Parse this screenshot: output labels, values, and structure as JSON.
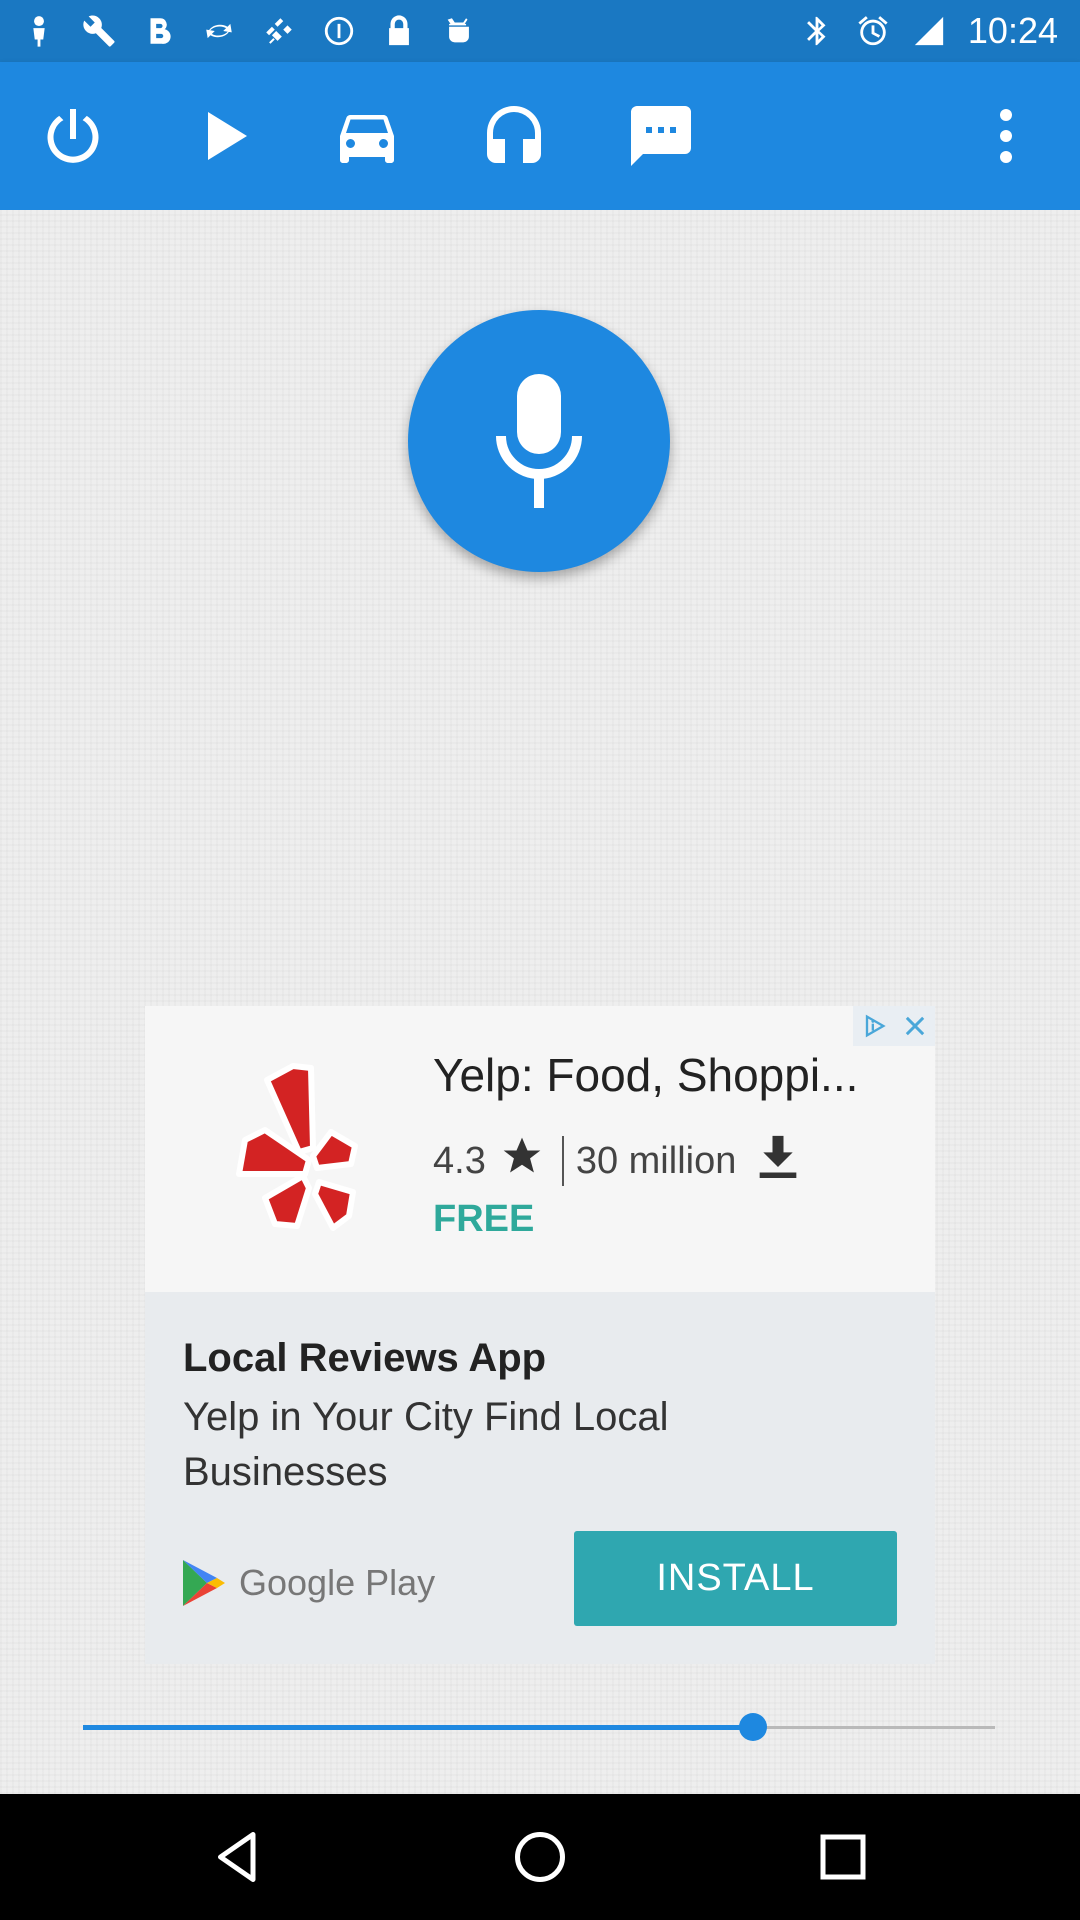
{
  "status_bar": {
    "time": "10:24",
    "left_icons": [
      "person-pin-icon",
      "wrench-icon",
      "bold-b-icon",
      "swirl-icon",
      "fake-gps-icon",
      "info-circle-icon",
      "lock-icon",
      "android-icon"
    ],
    "right_icons": [
      "bluetooth-icon",
      "alarm-icon",
      "signal-icon"
    ]
  },
  "app_bar": {
    "icons": [
      "power-icon",
      "play-icon",
      "car-icon",
      "headphones-icon",
      "message-icon",
      "more-vert-icon"
    ]
  },
  "mic": {
    "icon": "microphone-icon"
  },
  "ad": {
    "app_name": "Yelp: Food, Shoppi...",
    "rating": "4.3",
    "downloads": "30 million",
    "price": "FREE",
    "headline": "Local Reviews App",
    "body": "Yelp in Your City Find Local Businesses",
    "store": "Google Play",
    "install_label": "INSTALL"
  },
  "slider": {
    "value": 0.735
  },
  "nav_bar": {
    "icons": [
      "back-icon",
      "home-icon",
      "recents-icon"
    ]
  },
  "colors": {
    "primary": "#1e88e0",
    "status_bar": "#1a78c2",
    "accent_teal": "#2fa7b0",
    "yelp_red": "#d32323"
  }
}
